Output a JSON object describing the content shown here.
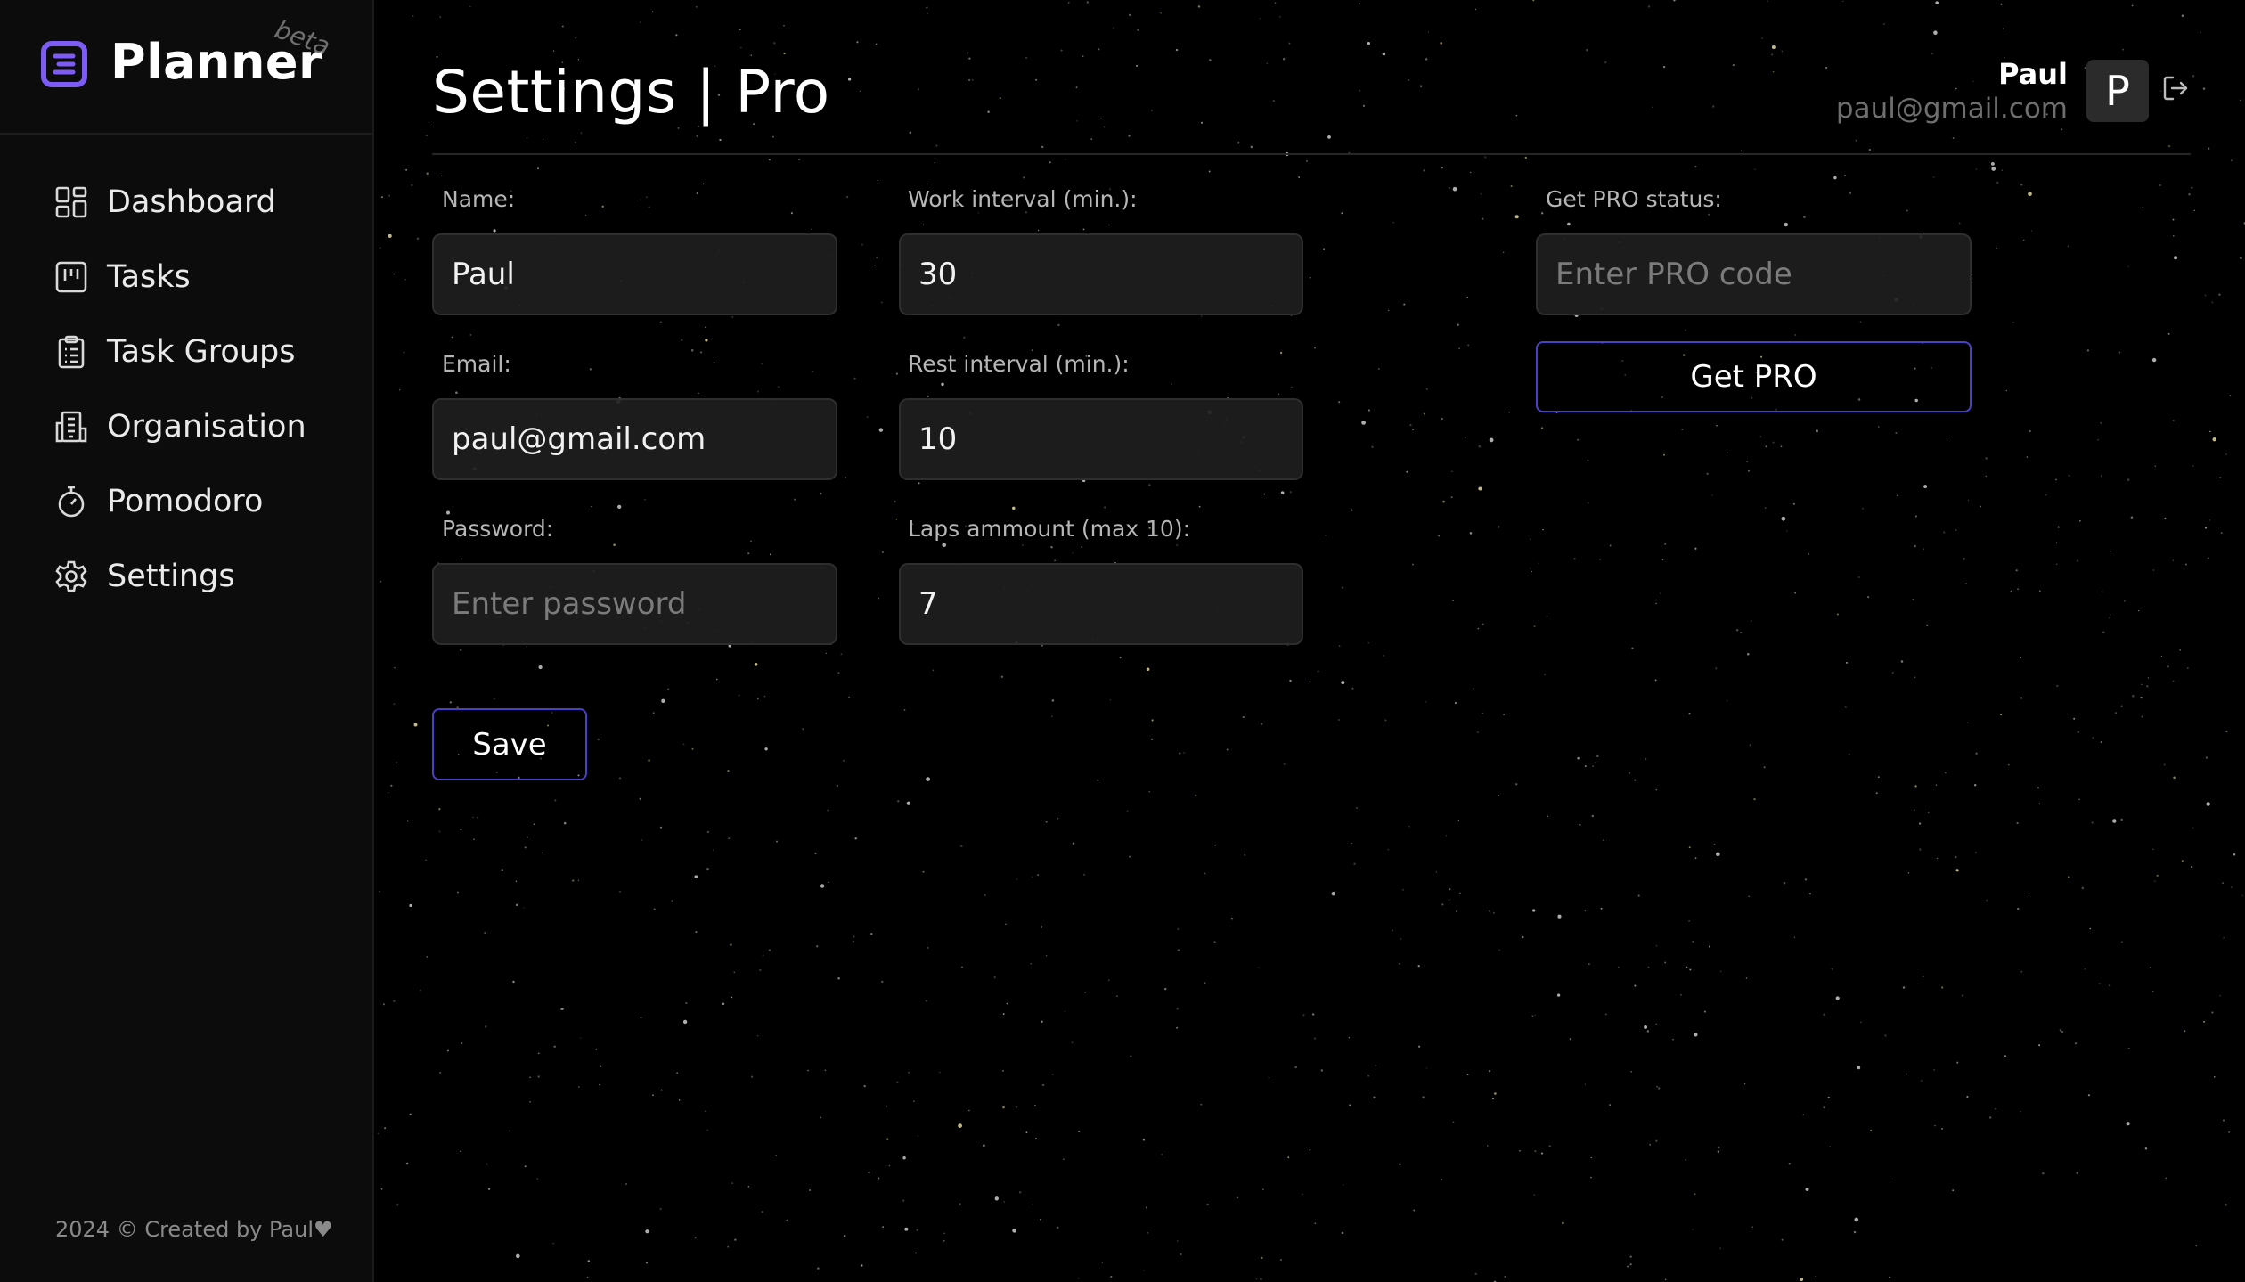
{
  "app": {
    "name": "Planner",
    "badge": "beta"
  },
  "sidebar": {
    "items": [
      {
        "label": "Dashboard",
        "icon": "dashboard-icon"
      },
      {
        "label": "Tasks",
        "icon": "kanban-icon"
      },
      {
        "label": "Task Groups",
        "icon": "clipboard-icon"
      },
      {
        "label": "Organisation",
        "icon": "building-icon"
      },
      {
        "label": "Pomodoro",
        "icon": "timer-icon"
      },
      {
        "label": "Settings",
        "icon": "gear-icon"
      }
    ],
    "footer": "2024 © Created by Paul♥"
  },
  "header": {
    "title": "Settings | Pro",
    "user": {
      "name": "Paul",
      "email": "paul@gmail.com",
      "initial": "P"
    }
  },
  "form": {
    "name": {
      "label": "Name:",
      "value": "Paul",
      "placeholder": ""
    },
    "email": {
      "label": "Email:",
      "value": "paul@gmail.com",
      "placeholder": ""
    },
    "password": {
      "label": "Password:",
      "value": "",
      "placeholder": "Enter password"
    },
    "work_interval": {
      "label": "Work interval (min.):",
      "value": "30"
    },
    "rest_interval": {
      "label": "Rest interval (min.):",
      "value": "10"
    },
    "laps": {
      "label": "Laps ammount (max 10):",
      "value": "7"
    },
    "save_label": "Save"
  },
  "pro": {
    "label": "Get PRO status:",
    "placeholder": "Enter PRO code",
    "button_label": "Get PRO"
  },
  "colors": {
    "accent": "#7c5cf5",
    "button_border": "#4b3fc7",
    "sidebar_bg": "#0c0c0c",
    "page_bg": "#000000"
  }
}
